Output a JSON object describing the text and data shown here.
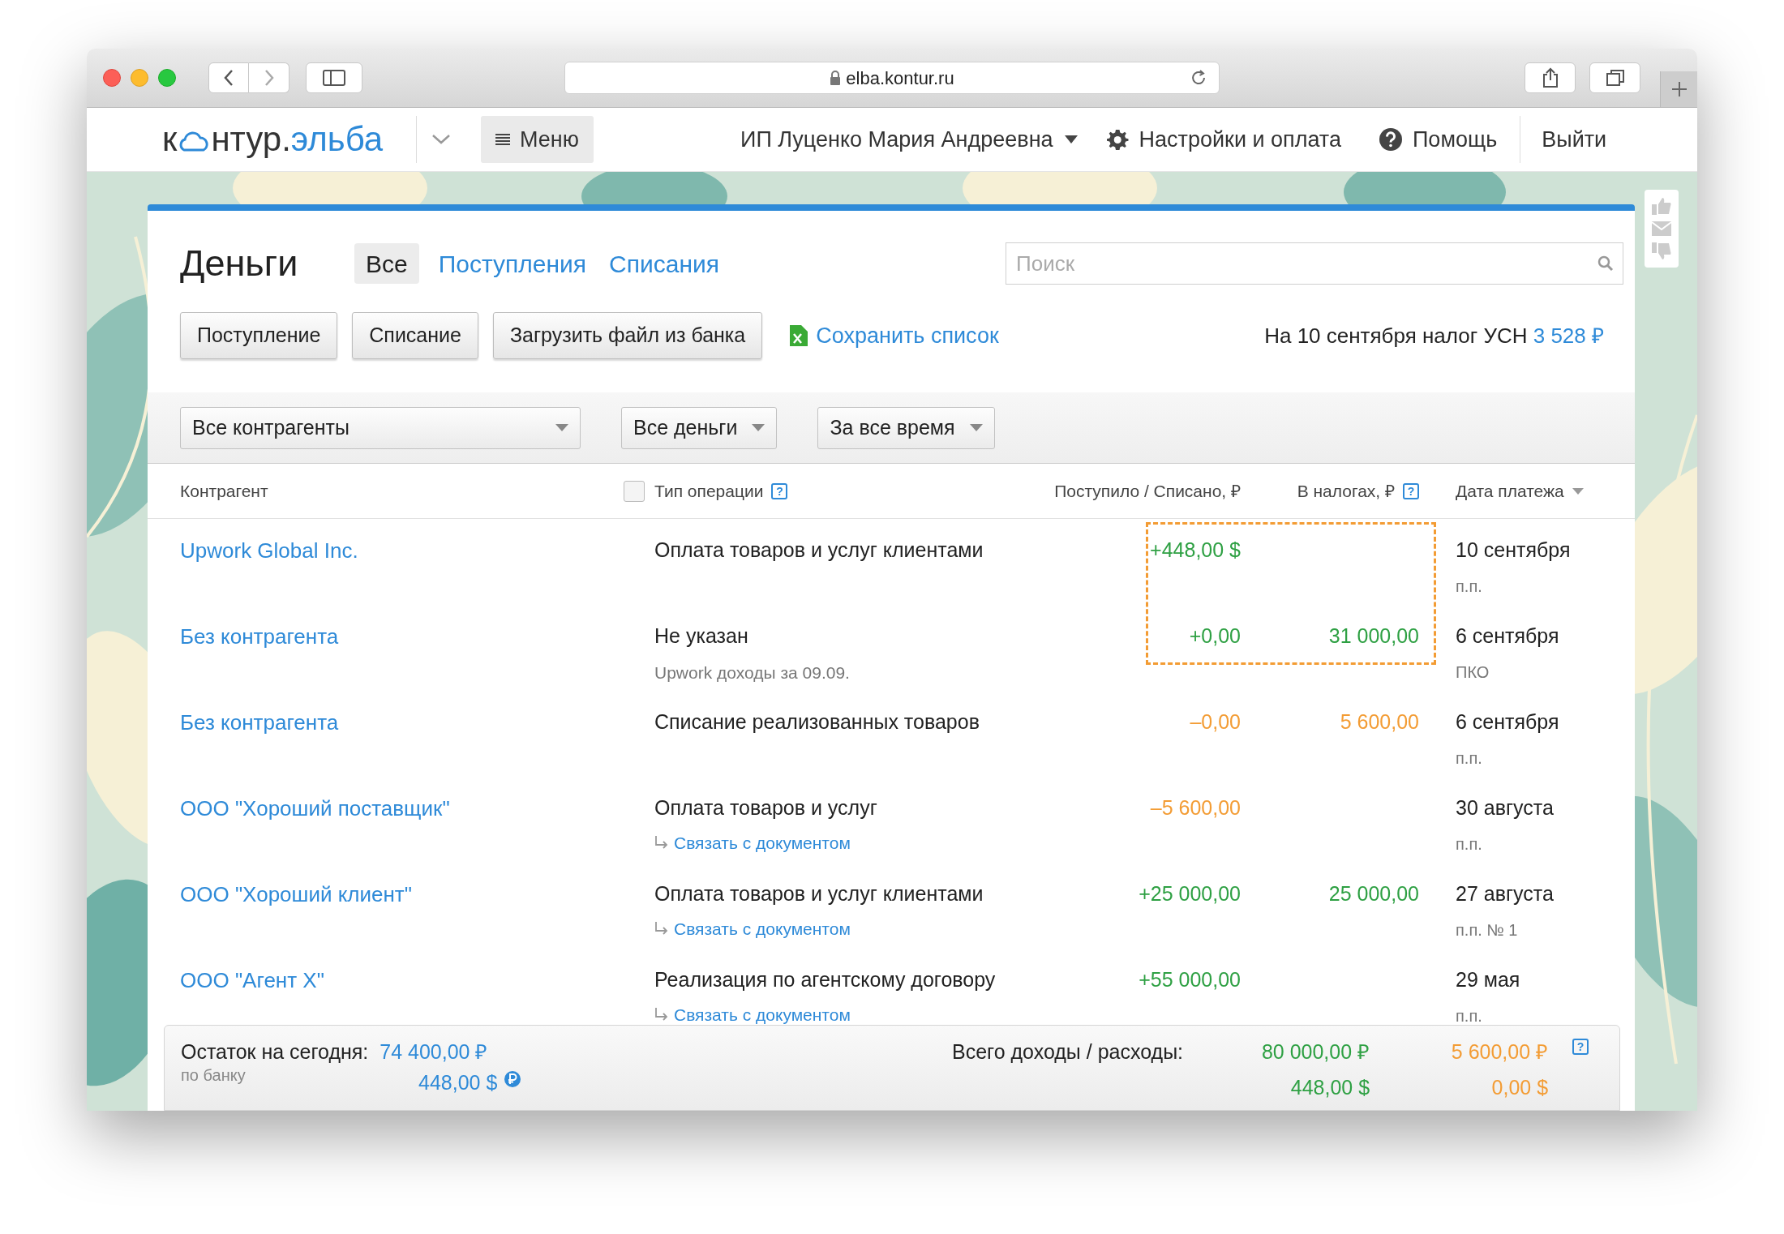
{
  "browser": {
    "url": "elba.kontur.ru"
  },
  "header": {
    "logo": {
      "prefix": "к",
      "rest": "нтур.",
      "product": "эльба"
    },
    "menu": "Меню",
    "user": "ИП Луценко Мария Андреевна",
    "settings": "Настройки и оплата",
    "help": "Помощь",
    "logout": "Выйти"
  },
  "page": {
    "title": "Деньги",
    "tabs": [
      {
        "label": "Все",
        "selected": true
      },
      {
        "label": "Поступления",
        "selected": false
      },
      {
        "label": "Списания",
        "selected": false
      }
    ],
    "search": {
      "placeholder": "Поиск"
    },
    "actions": [
      "Поступление",
      "Списание",
      "Загрузить файл из банка"
    ],
    "save_link": "Сохранить список",
    "tax_notice": {
      "text": "На 10 сентября налог УСН",
      "amount": "3 528 ₽"
    },
    "filters": [
      "Все контрагенты",
      "Все деньги",
      "За все время"
    ]
  },
  "table": {
    "select_all_checked": false,
    "columns": [
      {
        "label": "Контрагент"
      },
      {
        "label": "Тип операции",
        "help": "?"
      },
      {
        "label": "Поступило / Списано, ₽"
      },
      {
        "label": "В налогах, ₽",
        "help": "?"
      },
      {
        "label": "Дата платежа",
        "sorted": true
      }
    ],
    "rows": [
      {
        "counterparty": "Upwork Global Inc.",
        "operation": "Оплата товаров и услуг клиентами",
        "amount": {
          "text": "+448,00 $",
          "kind": "income"
        },
        "date": "10 сентября",
        "doc": "п.п.",
        "highlighted": true
      },
      {
        "counterparty": "Без контрагента",
        "operation": "Не указан",
        "note": "Upwork доходы за 09.09.",
        "amount": {
          "text": "+0,00",
          "kind": "income"
        },
        "tax": {
          "text": "31 000,00",
          "kind": "income"
        },
        "date": "6 сентября",
        "doc": "ПКО",
        "highlighted": true
      },
      {
        "counterparty": "Без контрагента",
        "operation": "Списание реализованных товаров",
        "amount": {
          "text": "–0,00",
          "kind": "expense"
        },
        "tax": {
          "text": "5 600,00",
          "kind": "expense"
        },
        "date": "6 сентября",
        "doc": "п.п.",
        "highlighted": false
      },
      {
        "counterparty": "ООО \"Хороший поставщик\"",
        "operation": "Оплата товаров и услуг",
        "link": "Связать с документом",
        "amount": {
          "text": "–5 600,00",
          "kind": "expense"
        },
        "date": "30 августа",
        "doc": "п.п.",
        "highlighted": false
      },
      {
        "counterparty": "ООО \"Хороший клиент\"",
        "operation": "Оплата товаров и услуг клиентами",
        "link": "Связать с документом",
        "amount": {
          "text": "+25 000,00",
          "kind": "income"
        },
        "tax": {
          "text": "25 000,00",
          "kind": "income"
        },
        "date": "27 августа",
        "doc": "п.п. № 1",
        "highlighted": false
      },
      {
        "counterparty": "ООО \"Агент X\"",
        "operation": "Реализация по агентскому договору",
        "link": "Связать с документом",
        "amount": {
          "text": "+55 000,00",
          "kind": "income"
        },
        "date": "29 мая",
        "doc": "п.п.",
        "highlighted": false
      }
    ]
  },
  "footer": {
    "balance_label": "Остаток на сегодня:",
    "balance_sub": "по банку",
    "balance": [
      "74 400,00 ₽",
      "448,00 $"
    ],
    "totals_label": "Всего доходы / расходы:",
    "income": [
      "80 000,00 ₽",
      "448,00 $"
    ],
    "expense": [
      "5 600,00 ₽",
      "0,00 $"
    ],
    "help": "?"
  }
}
